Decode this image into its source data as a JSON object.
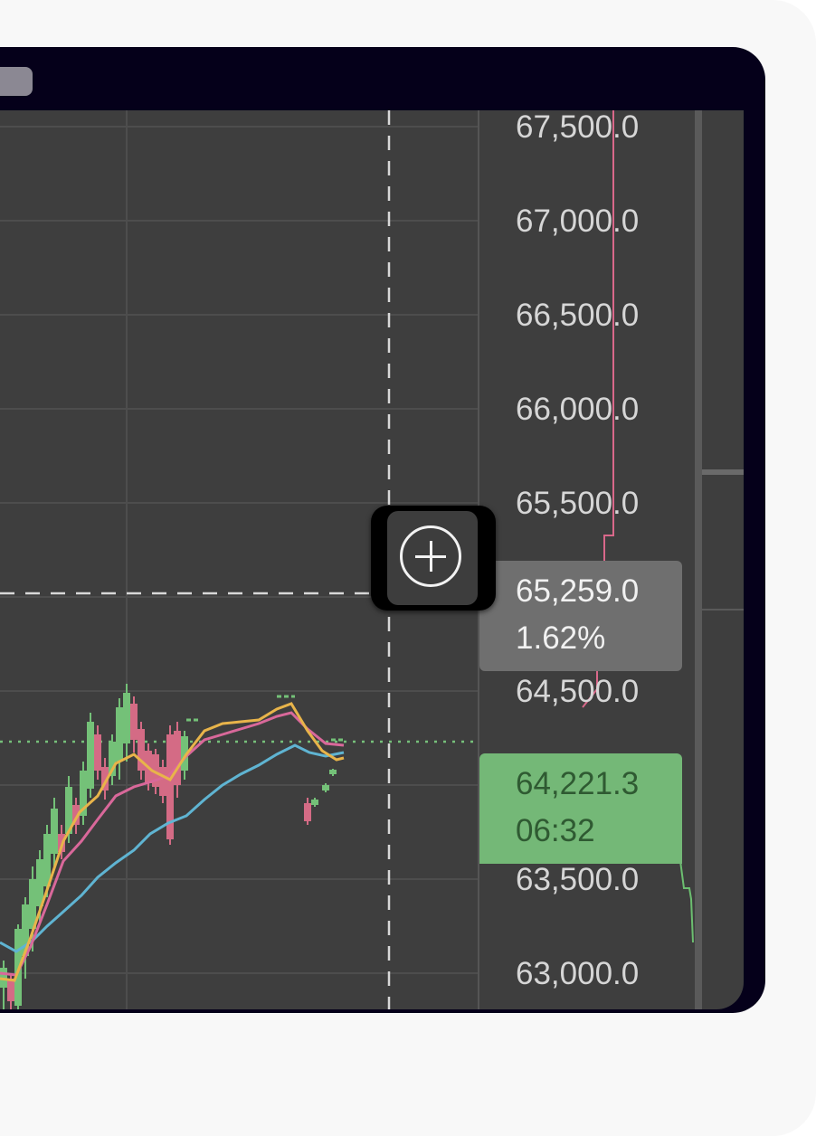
{
  "price_axis": {
    "labels": [
      "67,500.0",
      "67,000.0",
      "66,500.0",
      "66,000.0",
      "65,500.0",
      "64,500.0",
      "63,500.0",
      "63,000.0"
    ]
  },
  "crosshair": {
    "price": "65,259.0",
    "change": "1.62%"
  },
  "last_price": {
    "price": "64,221.3",
    "countdown": "06:32"
  },
  "cursor": {
    "icon": "crosshair-plus-icon"
  },
  "colors": {
    "window_frame": "#05001a",
    "chart_background": "#3e3e3e",
    "up_candle": "#74c178",
    "down_candle": "#d46b85",
    "ma_fast": "#e8b44a",
    "ma_mid": "#d9689a",
    "ma_slow": "#5fb4d2",
    "last_price_badge": "#74b877",
    "crosshair_badge": "#6f6f6f"
  }
}
